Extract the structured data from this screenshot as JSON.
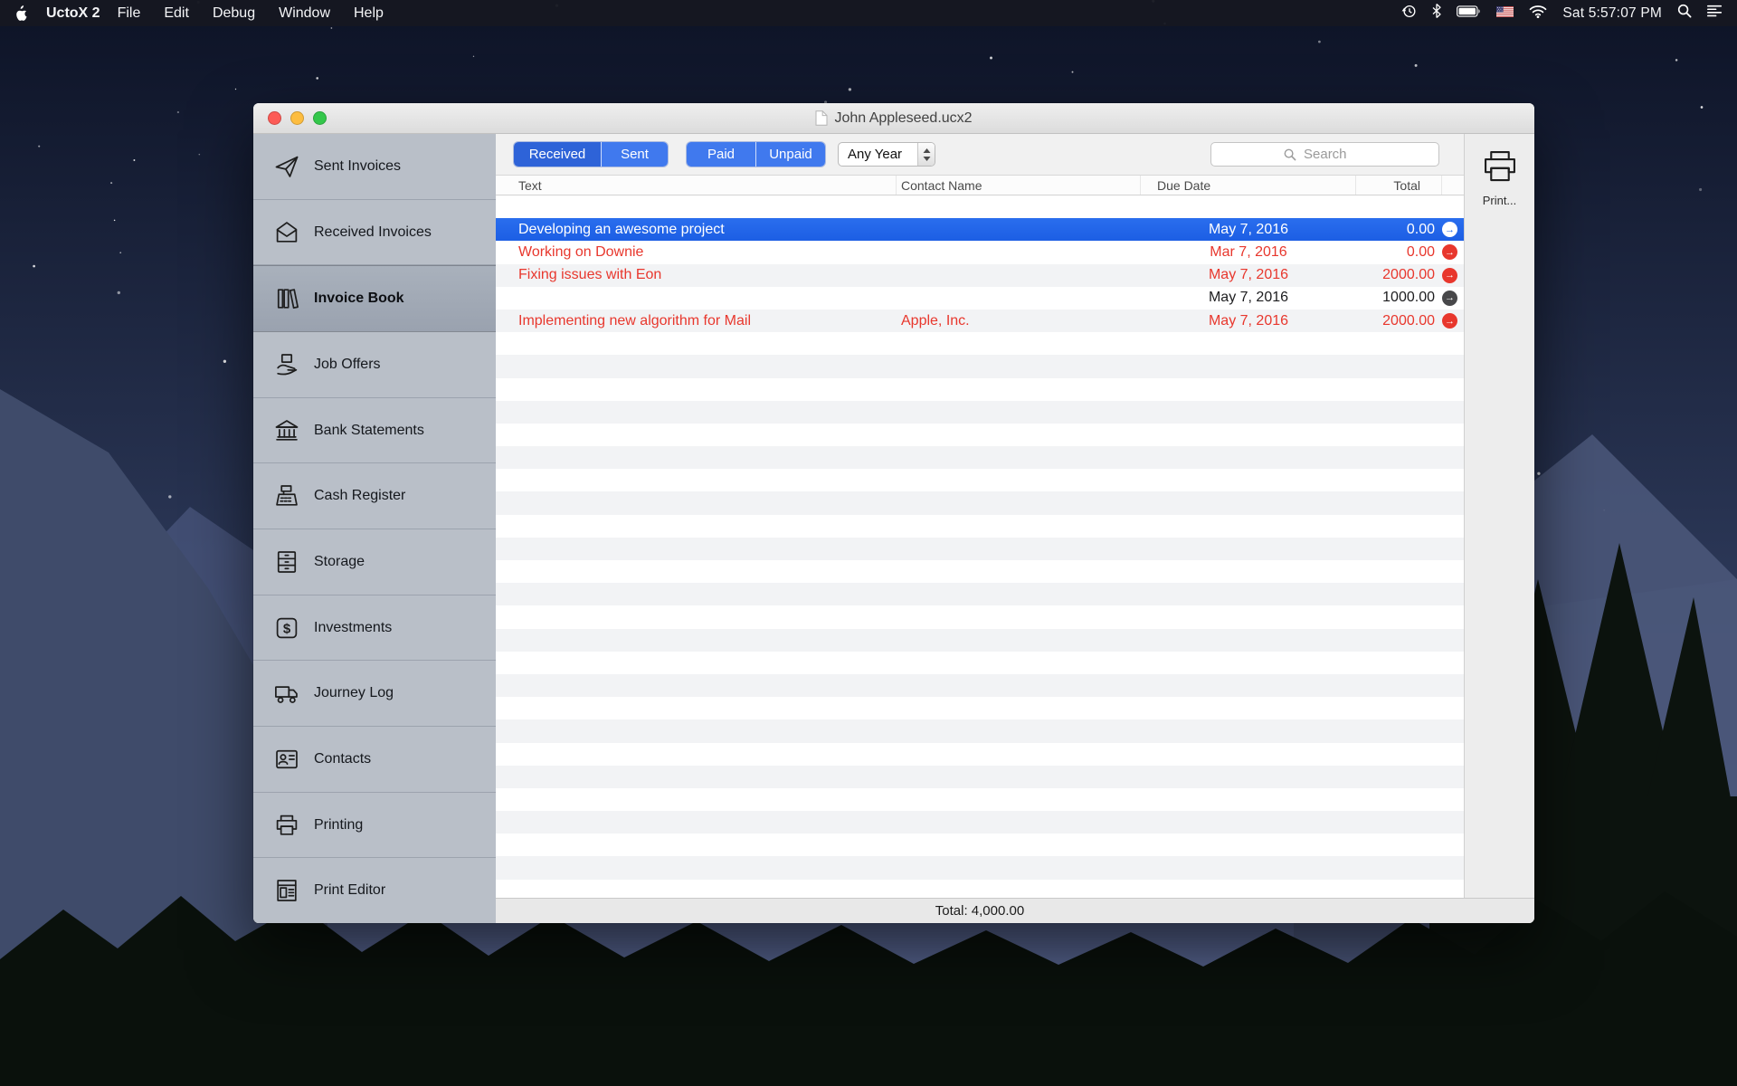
{
  "menu_bar": {
    "app_name": "UctoX 2",
    "menus": [
      "File",
      "Edit",
      "Debug",
      "Window",
      "Help"
    ],
    "clock": "Sat 5:57:07 PM",
    "status_icons": [
      "time-machine",
      "bluetooth",
      "battery",
      "us-flag",
      "wifi",
      "spotlight",
      "notification-center"
    ]
  },
  "icons": {
    "row_arrow": "→"
  },
  "colors": {
    "accent_blue": "#4079ee",
    "selected_row_blue": "#1f66e8",
    "overdue_red": "#e8372d",
    "sidebar_gray": "#b9bfc8"
  },
  "window": {
    "title": "John Appleseed.ucx2",
    "sidebar": {
      "items": [
        {
          "label": "Sent Invoices",
          "icon": "paper-plane-icon"
        },
        {
          "label": "Received Invoices",
          "icon": "envelope-icon"
        },
        {
          "label": "Invoice Book",
          "icon": "invoice-book-icon",
          "selected": true
        },
        {
          "label": "Job Offers",
          "icon": "job-offers-icon"
        },
        {
          "label": "Bank Statements",
          "icon": "bank-icon"
        },
        {
          "label": "Cash Register",
          "icon": "cash-register-icon"
        },
        {
          "label": "Storage",
          "icon": "storage-icon"
        },
        {
          "label": "Investments",
          "icon": "investments-icon"
        },
        {
          "label": "Journey Log",
          "icon": "journey-log-icon"
        },
        {
          "label": "Contacts",
          "icon": "contacts-icon"
        },
        {
          "label": "Printing",
          "icon": "printing-icon"
        },
        {
          "label": "Print Editor",
          "icon": "print-editor-icon"
        }
      ]
    },
    "toolbar": {
      "received_sent": [
        "Received",
        "Sent"
      ],
      "paid_unpaid": [
        "Paid",
        "Unpaid"
      ],
      "year_filter": "Any Year",
      "search_placeholder": "Search",
      "print_label": "Print..."
    },
    "table": {
      "columns": [
        "Text",
        "Contact Name",
        "Due Date",
        "Total"
      ],
      "rows": [
        {
          "text": "Developing an awesome project",
          "contact": "",
          "due_date": "May 7, 2016",
          "total": "0.00",
          "state": "selected"
        },
        {
          "text": "Working on Downie",
          "contact": "",
          "due_date": "Mar 7, 2016",
          "total": "0.00",
          "state": "overdue"
        },
        {
          "text": "Fixing issues with Eon",
          "contact": "",
          "due_date": "May 7, 2016",
          "total": "2000.00",
          "state": "overdue"
        },
        {
          "text": "",
          "contact": "",
          "due_date": "May 7, 2016",
          "total": "1000.00",
          "state": "normal"
        },
        {
          "text": "Implementing new algorithm for Mail",
          "contact": "Apple, Inc.",
          "due_date": "May 7, 2016",
          "total": "2000.00",
          "state": "overdue"
        }
      ],
      "footer_total": "Total: 4,000.00"
    }
  }
}
